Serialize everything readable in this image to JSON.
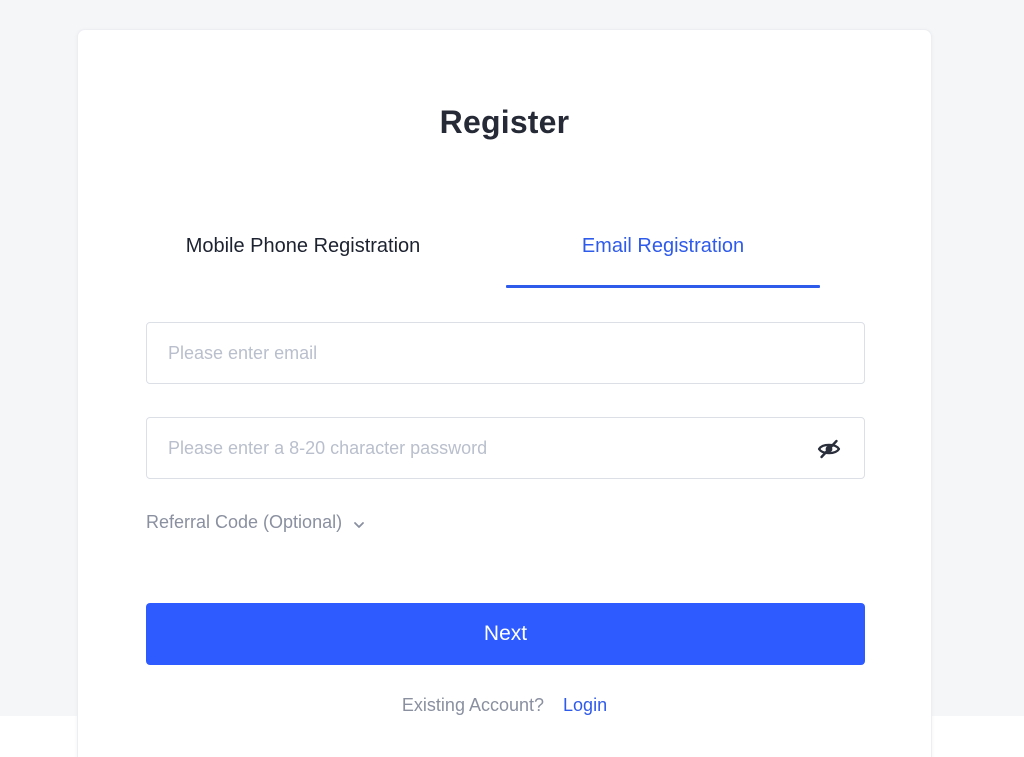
{
  "form": {
    "title": "Register",
    "tabs": [
      {
        "label": "Mobile Phone Registration",
        "active": false
      },
      {
        "label": "Email Registration",
        "active": true
      }
    ],
    "email": {
      "placeholder": "Please enter email",
      "value": ""
    },
    "password": {
      "placeholder": "Please enter a 8-20 character password",
      "value": "",
      "toggle_icon": "eye-slash-icon"
    },
    "referral": {
      "label": "Referral Code (Optional)",
      "icon": "chevron-down-icon"
    },
    "next_label": "Next",
    "login_prompt": "Existing Account?",
    "login_link": "Login"
  },
  "colors": {
    "accent": "#2e5bff",
    "active_tab": "#2f5bea",
    "page_bg": "#f5f6f8"
  }
}
